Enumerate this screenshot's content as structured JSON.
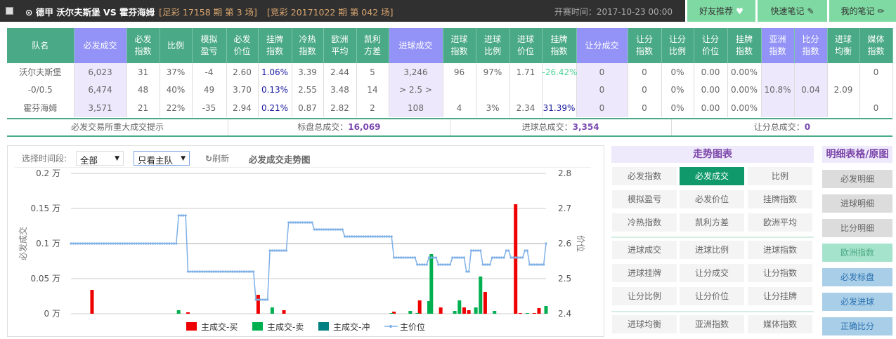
{
  "header": {
    "title": "⊙ 德甲  沃尔夫斯堡  VS 霍芬海姆",
    "issue1": "[足彩 17158 期 第 3 场]",
    "issue2": "[竞彩 20171022 期 第 042 场]",
    "kickoff": "开赛时间：2017-10-23 00:00",
    "buttons": [
      {
        "label": "好友推荐",
        "icon": "heart-icon"
      },
      {
        "label": "快速笔记",
        "icon": "edit-icon"
      },
      {
        "label": "我的笔记",
        "icon": "pencil-icon"
      }
    ]
  },
  "table": {
    "headers": [
      "队名",
      "必发成交",
      "必发\n指数",
      "比例",
      "模拟\n盈亏",
      "必发\n价位",
      "挂牌\n指数",
      "冷热\n指数",
      "欧洲\n平均",
      "凯利\n方差",
      "进球成交",
      "进球\n指数",
      "进球\n比例",
      "进球\n价位",
      "挂牌\n指数",
      "让分成交",
      "让分\n指数",
      "让分\n比例",
      "让分\n价位",
      "挂牌\n指数",
      "亚洲\n指数",
      "比分\n指数",
      "进球\n均衡",
      "媒体\n指数"
    ],
    "rows": [
      [
        "沃尔夫斯堡",
        "6,023",
        "31",
        "37%",
        "-4",
        "2.60",
        "1.06%",
        "3.39",
        "2.44",
        "5",
        "3,246",
        "96",
        "97%",
        "1.71",
        "-26.42%",
        "0",
        "0",
        "0%",
        "0.00",
        "0.00%",
        "",
        "",
        "",
        "0"
      ],
      [
        "-0/0.5",
        "6,474",
        "48",
        "40%",
        "49",
        "3.70",
        "0.13%",
        "2.55",
        "3.48",
        "14",
        "> 2.5 >",
        "",
        "",
        "",
        "",
        "0",
        "0",
        "0%",
        "0.00",
        "0.00%",
        "10.8%",
        "0.04",
        "2.09",
        ""
      ],
      [
        "霍芬海姆",
        "3,571",
        "21",
        "22%",
        "-35",
        "2.94",
        "0.21%",
        "0.87",
        "2.82",
        "2",
        "108",
        "4",
        "3%",
        "2.34",
        "31.39%",
        "0",
        "0",
        "0%",
        "0.00",
        "0.00%",
        "",
        "",
        "",
        "0"
      ]
    ],
    "summary": [
      {
        "label": "必发交易所重大成交提示",
        "value": ""
      },
      {
        "label": "标盘总成交：",
        "value": "16,069"
      },
      {
        "label": "进球总成交：",
        "value": "3,354"
      },
      {
        "label": "让分总成交：",
        "value": "0"
      }
    ]
  },
  "toolbar": {
    "period_label": "选择时间段:",
    "period_value": "全部",
    "team_value": "只看主队",
    "refresh": "刷新",
    "chart_title": "必发成交走势图"
  },
  "chart_data": {
    "type": "bar+line",
    "title": "必发成交走势图",
    "ylabel": "必发成交",
    "y2label": "价位",
    "yticks": [
      "0.2 万",
      "0.15 万",
      "0.1 万",
      "0.05 万",
      "0 万"
    ],
    "y2ticks": [
      "2.8",
      "2.7",
      "2.6",
      "2.5",
      "2.4"
    ],
    "ylim": [
      0,
      0.2
    ],
    "y2lim": [
      2.4,
      2.8
    ],
    "grid": true,
    "legend": "bottom",
    "colors": {
      "buy": "#ee0000",
      "sell": "#00b050",
      "rush": "#008080",
      "price": "#7fb0e6"
    },
    "legend_labels": [
      "主成交-买",
      "主成交-卖",
      "主成交-冲",
      "主价位"
    ],
    "buy": [
      [
        9,
        0.034
      ],
      [
        50,
        0.002
      ],
      [
        80,
        0.027
      ],
      [
        91,
        0.005
      ],
      [
        138,
        0.003
      ],
      [
        149,
        0.019
      ],
      [
        158,
        0.009
      ],
      [
        168,
        0.009
      ],
      [
        170,
        0.005
      ],
      [
        177,
        0.031
      ],
      [
        190,
        0.156
      ],
      [
        192,
        0.001
      ],
      [
        198,
        0.001
      ],
      [
        200,
        0.008
      ]
    ],
    "sell": [
      [
        46,
        0.005
      ],
      [
        86,
        0.009
      ],
      [
        137,
        0.001
      ],
      [
        145,
        0.004
      ],
      [
        148,
        0.001
      ],
      [
        153,
        0.018
      ],
      [
        154,
        0.085
      ],
      [
        164,
        0.004
      ],
      [
        166,
        0.019
      ],
      [
        173,
        0.009
      ],
      [
        175,
        0.053
      ],
      [
        181,
        0.004
      ],
      [
        195,
        0.001
      ],
      [
        203,
        0.011
      ]
    ],
    "rush": [],
    "price": [
      2.6,
      2.6,
      2.6,
      2.6,
      2.6,
      2.6,
      2.6,
      2.6,
      2.6,
      2.6,
      2.6,
      2.6,
      2.6,
      2.6,
      2.6,
      2.6,
      2.6,
      2.6,
      2.6,
      2.6,
      2.6,
      2.6,
      2.6,
      2.6,
      2.6,
      2.6,
      2.6,
      2.6,
      2.6,
      2.6,
      2.6,
      2.6,
      2.6,
      2.6,
      2.6,
      2.6,
      2.6,
      2.6,
      2.6,
      2.6,
      2.6,
      2.6,
      2.6,
      2.6,
      2.6,
      2.6,
      2.68,
      2.68,
      2.68,
      2.68,
      2.52,
      2.52,
      2.52,
      2.52,
      2.52,
      2.52,
      2.52,
      2.52,
      2.52,
      2.52,
      2.52,
      2.52,
      2.52,
      2.52,
      2.52,
      2.52,
      2.52,
      2.52,
      2.52,
      2.52,
      2.52,
      2.52,
      2.52,
      2.52,
      2.52,
      2.52,
      2.52,
      2.52,
      2.52,
      2.44,
      2.44,
      2.44,
      2.44,
      2.44,
      2.44,
      2.58,
      2.58,
      2.58,
      2.58,
      2.58,
      2.58,
      2.58,
      2.58,
      2.66,
      2.66,
      2.66,
      2.66,
      2.66,
      2.66,
      2.66,
      2.66,
      2.66,
      2.66,
      2.66,
      2.64,
      2.64,
      2.64,
      2.64,
      2.64,
      2.64,
      2.64,
      2.64,
      2.64,
      2.64,
      2.64,
      2.64,
      2.64,
      2.62,
      2.62,
      2.62,
      2.62,
      2.62,
      2.62,
      2.62,
      2.62,
      2.62,
      2.62,
      2.62,
      2.62,
      2.62,
      2.62,
      2.62,
      2.62,
      2.62,
      2.62,
      2.62,
      2.62,
      2.62,
      2.56,
      2.56,
      2.56,
      2.56,
      2.56,
      2.56,
      2.56,
      2.56,
      2.56,
      2.56,
      2.54,
      2.54,
      2.54,
      2.54,
      2.54,
      2.56,
      2.56,
      2.56,
      2.56,
      2.54,
      2.54,
      2.54,
      2.54,
      2.54,
      2.54,
      2.56,
      2.56,
      2.56,
      2.56,
      2.56,
      2.56,
      2.52,
      2.52,
      2.58,
      2.58,
      2.58,
      2.58,
      2.58,
      2.54,
      2.54,
      2.54,
      2.54,
      2.56,
      2.56,
      2.56,
      2.56,
      2.56,
      2.56,
      2.58,
      2.58,
      2.56,
      2.56,
      2.56,
      2.56,
      2.56,
      2.56,
      2.58,
      2.58,
      2.54,
      2.54,
      2.54,
      2.54,
      2.54,
      2.54,
      2.54,
      2.6
    ]
  },
  "trend_panel": {
    "title": "走势图表",
    "active": "必发成交",
    "groups": [
      [
        "必发指数",
        "必发成交",
        "比例",
        "模拟盈亏",
        "必发价位",
        "挂牌指数",
        "冷热指数",
        "凯利方差",
        "欧洲平均"
      ],
      [
        "进球成交",
        "进球比例",
        "进球指数",
        "进球挂牌",
        "让分成交",
        "让分指数",
        "让分比例",
        "让分价位",
        "让分挂牌"
      ],
      [
        "进球均衡",
        "亚洲指数",
        "媒体指数"
      ]
    ]
  },
  "detail_panel": {
    "title": "明细表格/原图",
    "items": [
      {
        "label": "必发明细",
        "style": "gray"
      },
      {
        "label": "进球明细",
        "style": "gray"
      },
      {
        "label": "比分明细",
        "style": "gray"
      },
      {
        "label": "欧洲指数",
        "style": "green"
      },
      {
        "label": "必发标盘",
        "style": "blue"
      },
      {
        "label": "必发进球",
        "style": "blue"
      },
      {
        "label": "正确比分",
        "style": "blue"
      }
    ]
  }
}
